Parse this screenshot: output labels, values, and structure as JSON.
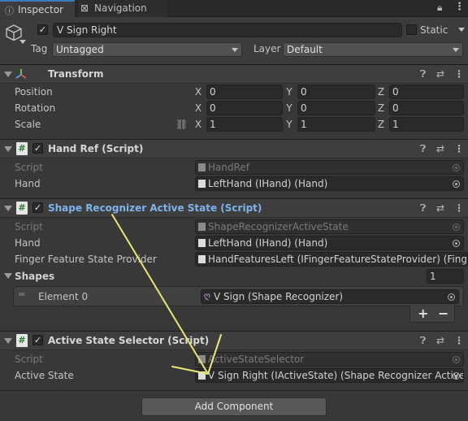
{
  "tabs": {
    "inspector": "Inspector",
    "navigation": "Navigation"
  },
  "header": {
    "object_name": "V Sign Right",
    "static_label": "Static",
    "tag_label": "Tag",
    "tag_value": "Untagged",
    "layer_label": "Layer",
    "layer_value": "Default"
  },
  "transform": {
    "title": "Transform",
    "rows": [
      {
        "label": "Position",
        "x": "0",
        "y": "0",
        "z": "0"
      },
      {
        "label": "Rotation",
        "x": "0",
        "y": "0",
        "z": "0"
      },
      {
        "label": "Scale",
        "x": "1",
        "y": "1",
        "z": "1"
      }
    ],
    "axis_x": "X",
    "axis_y": "Y",
    "axis_z": "Z"
  },
  "hand_ref": {
    "title": "Hand Ref (Script)",
    "script_label": "Script",
    "script_value": "HandRef",
    "hand_label": "Hand",
    "hand_value": "LeftHand (IHand) (Hand)"
  },
  "shape_recognizer": {
    "title": "Shape Recognizer Active State (Script)",
    "script_label": "Script",
    "script_value": "ShapeRecognizerActiveState",
    "hand_label": "Hand",
    "hand_value": "LeftHand (IHand) (Hand)",
    "provider_label": "Finger Feature State Provider",
    "provider_value": "HandFeaturesLeft (IFingerFeatureStateProvider) (Fing",
    "shapes_label": "Shapes",
    "shapes_count": "1",
    "element_label": "Element 0",
    "element_value": "V Sign (Shape Recognizer)",
    "add_label": "+",
    "remove_label": "−"
  },
  "selector": {
    "title": "Active State Selector (Script)",
    "script_label": "Script",
    "script_value": "ActiveStateSelector",
    "active_label": "Active State",
    "active_value": "V Sign Right (IActiveState) (Shape Recognizer Active"
  },
  "add_component": "Add Component",
  "colors": {
    "accent": "#3a79bb",
    "highlight_title": "#7fb3ec",
    "annotation_arrow": "#e6e67a"
  }
}
